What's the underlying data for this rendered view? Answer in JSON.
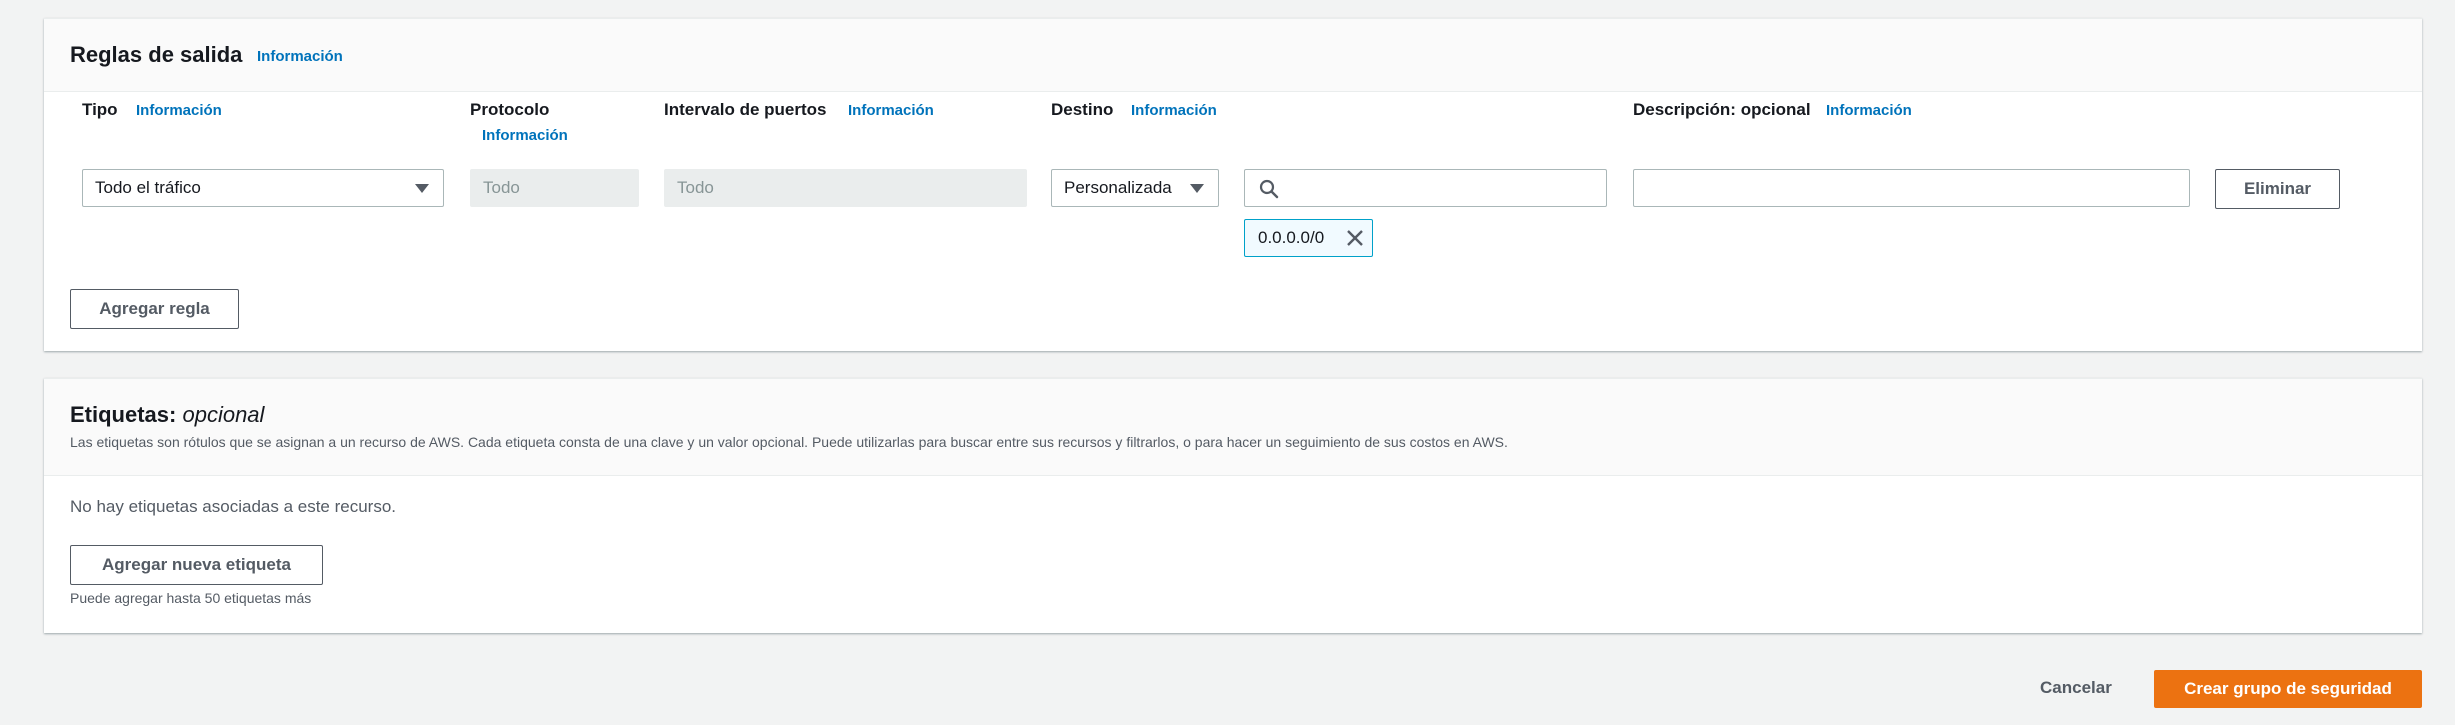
{
  "outbound": {
    "title": "Reglas de salida",
    "info": "Información",
    "columns": {
      "type": "Tipo",
      "protocol": "Protocolo",
      "port_range": "Intervalo de puertos",
      "destination": "Destino",
      "description": "Descripción: opcional",
      "info": "Información"
    },
    "rule": {
      "type_value": "Todo el tráfico",
      "protocol_value": "Todo",
      "port_value": "Todo",
      "destination_select": "Personalizada",
      "search_value": "",
      "cidr_token": "0.0.0.0/0",
      "description_value": "",
      "delete_label": "Eliminar"
    },
    "add_rule_label": "Agregar regla"
  },
  "tags": {
    "title": "Etiquetas: ",
    "title_optional": "opcional",
    "description": "Las etiquetas son rótulos que se asignan a un recurso de AWS. Cada etiqueta consta de una clave y un valor opcional. Puede utilizarlas para buscar entre sus recursos y filtrarlos, o para hacer un seguimiento de sus costos en AWS.",
    "empty_text": "No hay etiquetas asociadas a este recurso.",
    "add_tag_label": "Agregar nueva etiqueta",
    "limit_text": "Puede agregar hasta 50 etiquetas más"
  },
  "footer": {
    "cancel_label": "Cancelar",
    "create_label": "Crear grupo de seguridad"
  },
  "colors": {
    "primary": "#ec7211",
    "link": "#0073bb",
    "token_border": "#00a1c9"
  }
}
